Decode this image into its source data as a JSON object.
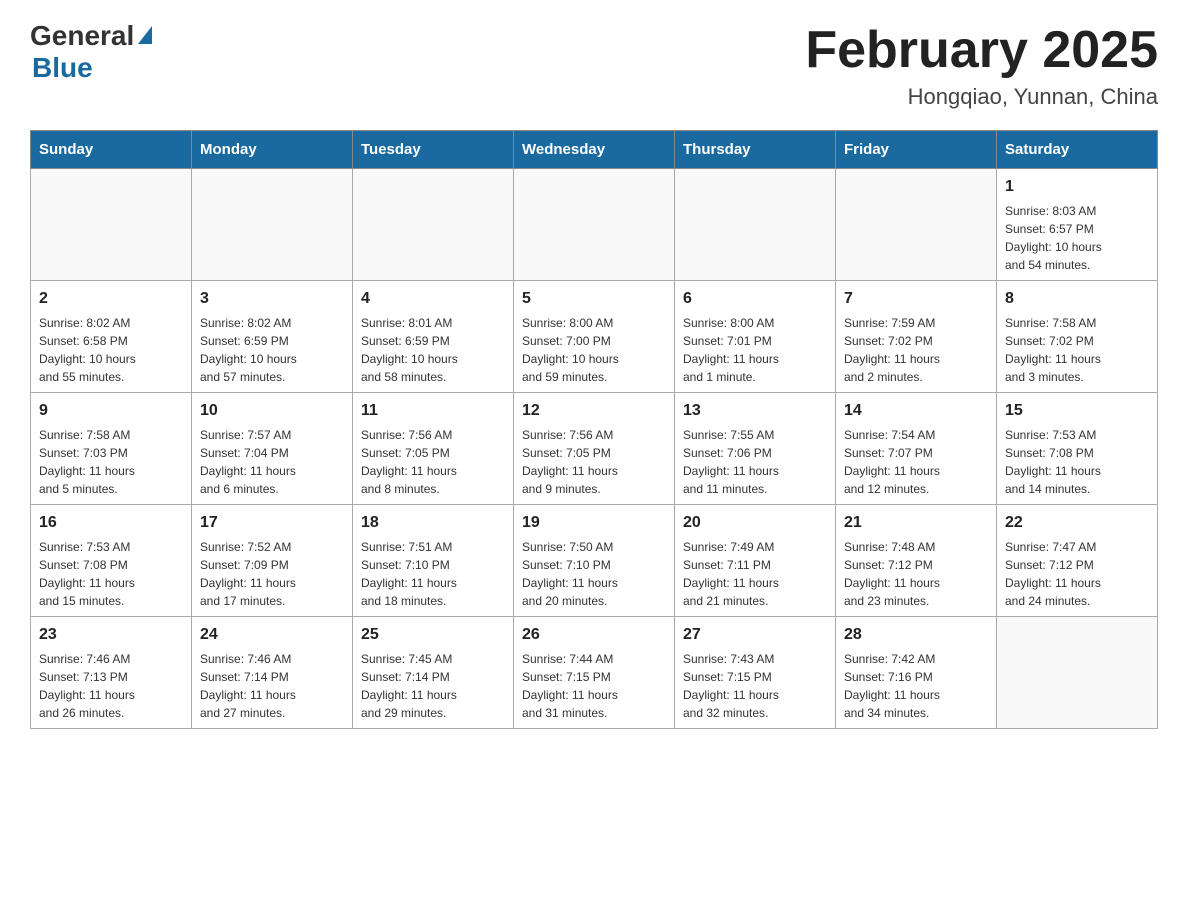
{
  "header": {
    "logo_general": "General",
    "logo_blue": "Blue",
    "title": "February 2025",
    "location": "Hongqiao, Yunnan, China"
  },
  "weekdays": [
    "Sunday",
    "Monday",
    "Tuesday",
    "Wednesday",
    "Thursday",
    "Friday",
    "Saturday"
  ],
  "weeks": [
    [
      {
        "day": "",
        "info": ""
      },
      {
        "day": "",
        "info": ""
      },
      {
        "day": "",
        "info": ""
      },
      {
        "day": "",
        "info": ""
      },
      {
        "day": "",
        "info": ""
      },
      {
        "day": "",
        "info": ""
      },
      {
        "day": "1",
        "info": "Sunrise: 8:03 AM\nSunset: 6:57 PM\nDaylight: 10 hours\nand 54 minutes."
      }
    ],
    [
      {
        "day": "2",
        "info": "Sunrise: 8:02 AM\nSunset: 6:58 PM\nDaylight: 10 hours\nand 55 minutes."
      },
      {
        "day": "3",
        "info": "Sunrise: 8:02 AM\nSunset: 6:59 PM\nDaylight: 10 hours\nand 57 minutes."
      },
      {
        "day": "4",
        "info": "Sunrise: 8:01 AM\nSunset: 6:59 PM\nDaylight: 10 hours\nand 58 minutes."
      },
      {
        "day": "5",
        "info": "Sunrise: 8:00 AM\nSunset: 7:00 PM\nDaylight: 10 hours\nand 59 minutes."
      },
      {
        "day": "6",
        "info": "Sunrise: 8:00 AM\nSunset: 7:01 PM\nDaylight: 11 hours\nand 1 minute."
      },
      {
        "day": "7",
        "info": "Sunrise: 7:59 AM\nSunset: 7:02 PM\nDaylight: 11 hours\nand 2 minutes."
      },
      {
        "day": "8",
        "info": "Sunrise: 7:58 AM\nSunset: 7:02 PM\nDaylight: 11 hours\nand 3 minutes."
      }
    ],
    [
      {
        "day": "9",
        "info": "Sunrise: 7:58 AM\nSunset: 7:03 PM\nDaylight: 11 hours\nand 5 minutes."
      },
      {
        "day": "10",
        "info": "Sunrise: 7:57 AM\nSunset: 7:04 PM\nDaylight: 11 hours\nand 6 minutes."
      },
      {
        "day": "11",
        "info": "Sunrise: 7:56 AM\nSunset: 7:05 PM\nDaylight: 11 hours\nand 8 minutes."
      },
      {
        "day": "12",
        "info": "Sunrise: 7:56 AM\nSunset: 7:05 PM\nDaylight: 11 hours\nand 9 minutes."
      },
      {
        "day": "13",
        "info": "Sunrise: 7:55 AM\nSunset: 7:06 PM\nDaylight: 11 hours\nand 11 minutes."
      },
      {
        "day": "14",
        "info": "Sunrise: 7:54 AM\nSunset: 7:07 PM\nDaylight: 11 hours\nand 12 minutes."
      },
      {
        "day": "15",
        "info": "Sunrise: 7:53 AM\nSunset: 7:08 PM\nDaylight: 11 hours\nand 14 minutes."
      }
    ],
    [
      {
        "day": "16",
        "info": "Sunrise: 7:53 AM\nSunset: 7:08 PM\nDaylight: 11 hours\nand 15 minutes."
      },
      {
        "day": "17",
        "info": "Sunrise: 7:52 AM\nSunset: 7:09 PM\nDaylight: 11 hours\nand 17 minutes."
      },
      {
        "day": "18",
        "info": "Sunrise: 7:51 AM\nSunset: 7:10 PM\nDaylight: 11 hours\nand 18 minutes."
      },
      {
        "day": "19",
        "info": "Sunrise: 7:50 AM\nSunset: 7:10 PM\nDaylight: 11 hours\nand 20 minutes."
      },
      {
        "day": "20",
        "info": "Sunrise: 7:49 AM\nSunset: 7:11 PM\nDaylight: 11 hours\nand 21 minutes."
      },
      {
        "day": "21",
        "info": "Sunrise: 7:48 AM\nSunset: 7:12 PM\nDaylight: 11 hours\nand 23 minutes."
      },
      {
        "day": "22",
        "info": "Sunrise: 7:47 AM\nSunset: 7:12 PM\nDaylight: 11 hours\nand 24 minutes."
      }
    ],
    [
      {
        "day": "23",
        "info": "Sunrise: 7:46 AM\nSunset: 7:13 PM\nDaylight: 11 hours\nand 26 minutes."
      },
      {
        "day": "24",
        "info": "Sunrise: 7:46 AM\nSunset: 7:14 PM\nDaylight: 11 hours\nand 27 minutes."
      },
      {
        "day": "25",
        "info": "Sunrise: 7:45 AM\nSunset: 7:14 PM\nDaylight: 11 hours\nand 29 minutes."
      },
      {
        "day": "26",
        "info": "Sunrise: 7:44 AM\nSunset: 7:15 PM\nDaylight: 11 hours\nand 31 minutes."
      },
      {
        "day": "27",
        "info": "Sunrise: 7:43 AM\nSunset: 7:15 PM\nDaylight: 11 hours\nand 32 minutes."
      },
      {
        "day": "28",
        "info": "Sunrise: 7:42 AM\nSunset: 7:16 PM\nDaylight: 11 hours\nand 34 minutes."
      },
      {
        "day": "",
        "info": ""
      }
    ]
  ]
}
